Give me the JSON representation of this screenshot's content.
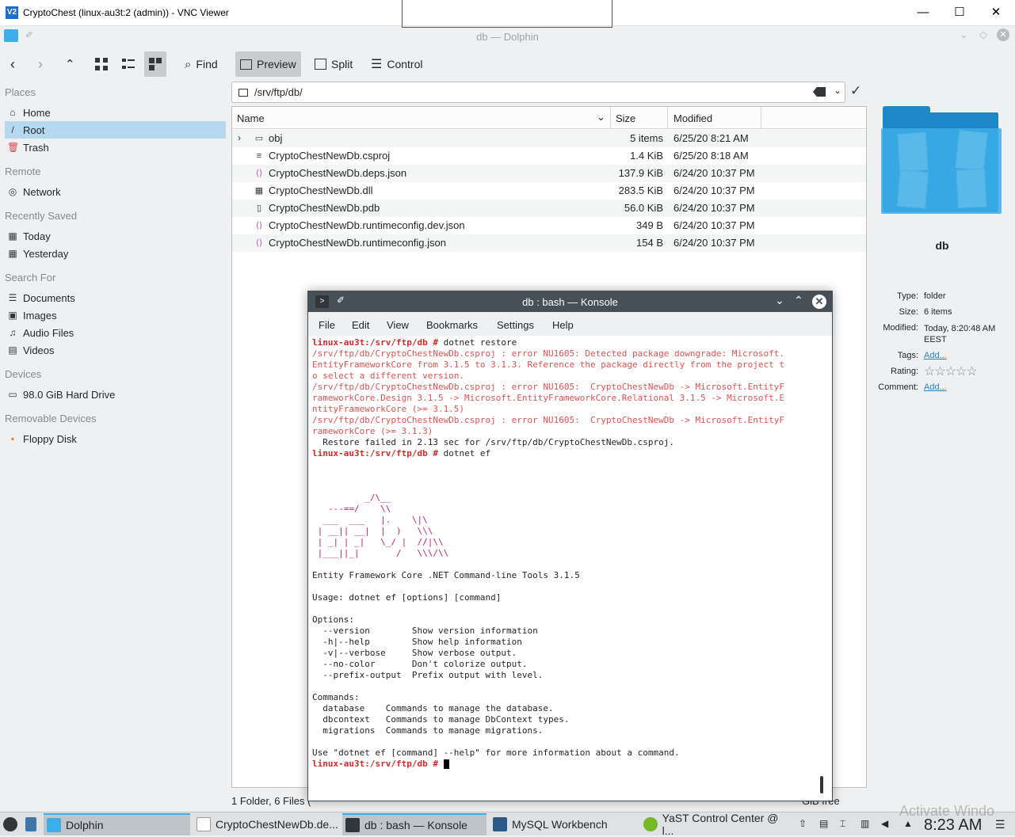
{
  "vnc": {
    "title": "CryptoChest (linux-au3t:2 (admin)) - VNC Viewer",
    "logo": "V2"
  },
  "dolphin": {
    "window_title": "db — Dolphin",
    "toolbar": {
      "find": "Find",
      "preview": "Preview",
      "split": "Split",
      "control": "Control"
    },
    "location": "/srv/ftp/db/",
    "places": {
      "sections": [
        "Places",
        "Remote",
        "Recently Saved",
        "Search For",
        "Devices",
        "Removable Devices"
      ],
      "home": "Home",
      "root": "Root",
      "trash": "Trash",
      "network": "Network",
      "today": "Today",
      "yesterday": "Yesterday",
      "documents": "Documents",
      "images": "Images",
      "audio": "Audio Files",
      "videos": "Videos",
      "hard_drive": "98.0 GiB Hard Drive",
      "floppy": "Floppy Disk"
    },
    "columns": {
      "name": "Name",
      "size": "Size",
      "modified": "Modified"
    },
    "files": [
      {
        "name": "obj",
        "size": "5 items",
        "modified": "6/25/20 8:21 AM",
        "icon": "folder-icon"
      },
      {
        "name": "CryptoChestNewDb.csproj",
        "size": "1.4 KiB",
        "modified": "6/25/20 8:18 AM",
        "icon": "text-file-icon"
      },
      {
        "name": "CryptoChestNewDb.deps.json",
        "size": "137.9 KiB",
        "modified": "6/24/20 10:37 PM",
        "icon": "json-file-icon"
      },
      {
        "name": "CryptoChestNewDb.dll",
        "size": "283.5 KiB",
        "modified": "6/24/20 10:37 PM",
        "icon": "binary-file-icon"
      },
      {
        "name": "CryptoChestNewDb.pdb",
        "size": "56.0 KiB",
        "modified": "6/24/20 10:37 PM",
        "icon": "file-icon"
      },
      {
        "name": "CryptoChestNewDb.runtimeconfig.dev.json",
        "size": "349 B",
        "modified": "6/24/20 10:37 PM",
        "icon": "json-file-icon"
      },
      {
        "name": "CryptoChestNewDb.runtimeconfig.json",
        "size": "154 B",
        "modified": "6/24/20 10:37 PM",
        "icon": "json-file-icon"
      }
    ],
    "status_left": "1 Folder, 6 Files (",
    "status_right": "GiB free",
    "info": {
      "name": "db",
      "type_label": "Type:",
      "type": "folder",
      "size_label": "Size:",
      "size": "6 items",
      "modified_label": "Modified:",
      "modified": "Today, 8:20:48 AM EEST",
      "tags_label": "Tags:",
      "tags": "Add...",
      "rating_label": "Rating:",
      "rating": 0,
      "comment_label": "Comment:",
      "comment": "Add..."
    }
  },
  "konsole": {
    "title": "db : bash — Konsole",
    "menu": [
      "File",
      "Edit",
      "View",
      "Bookmarks",
      "Settings",
      "Help"
    ],
    "prompt": "linux-au3t:/srv/ftp/db #",
    "cmd1": " dotnet restore",
    "errors": [
      "/srv/ftp/db/CryptoChestNewDb.csproj : error NU1605: Detected package downgrade: Microsoft.",
      "EntityFrameworkCore from 3.1.5 to 3.1.3. Reference the package directly from the project t",
      "o select a different version.",
      "/srv/ftp/db/CryptoChestNewDb.csproj : error NU1605:  CryptoChestNewDb -> Microsoft.EntityF",
      "rameworkCore.Design 3.1.5 -> Microsoft.EntityFrameworkCore.Relational 3.1.5 -> Microsoft.E",
      "ntityFrameworkCore (>= 3.1.5)",
      "/srv/ftp/db/CryptoChestNewDb.csproj : error NU1605:  CryptoChestNewDb -> Microsoft.EntityF",
      "rameworkCore (>= 3.1.3)"
    ],
    "restore_failed": "  Restore failed in 2.13 sec for /srv/ftp/db/CryptoChestNewDb.csproj.",
    "cmd2": " dotnet ef",
    "logo": "\n\n\n          _/\\__\n   ---==/    \\\\\n  ___  ___   |.    \\|\\\n | __|| __|  |  )   \\\\\\\n | _| | _|   \\_/ |  //|\\\\\n |___||_|       /   \\\\\\/\\\\",
    "banner": "Entity Framework Core .NET Command-line Tools 3.1.5",
    "usage": "Usage: dotnet ef [options] [command]",
    "options_title": "Options:",
    "options": [
      "  --version        Show version information",
      "  -h|--help        Show help information",
      "  -v|--verbose     Show verbose output.",
      "  --no-color       Don't colorize output.",
      "  --prefix-output  Prefix output with level."
    ],
    "commands_title": "Commands:",
    "commands": [
      "  database    Commands to manage the database.",
      "  dbcontext   Commands to manage DbContext types.",
      "  migrations  Commands to manage migrations."
    ],
    "help_hint": "Use \"dotnet ef [command] --help\" for more information about a command."
  },
  "taskbar": {
    "tasks": [
      "Dolphin",
      "CryptoChestNewDb.de...",
      "db : bash — Konsole",
      "MySQL Workbench",
      "YaST Control Center @ l..."
    ],
    "clock": "8:23 AM",
    "watermark": "Activate Windo"
  },
  "colors": {
    "accent": "#3daee9",
    "prompt": "#d02a2a",
    "error": "#e05252",
    "selection": "#b7d9f0"
  }
}
